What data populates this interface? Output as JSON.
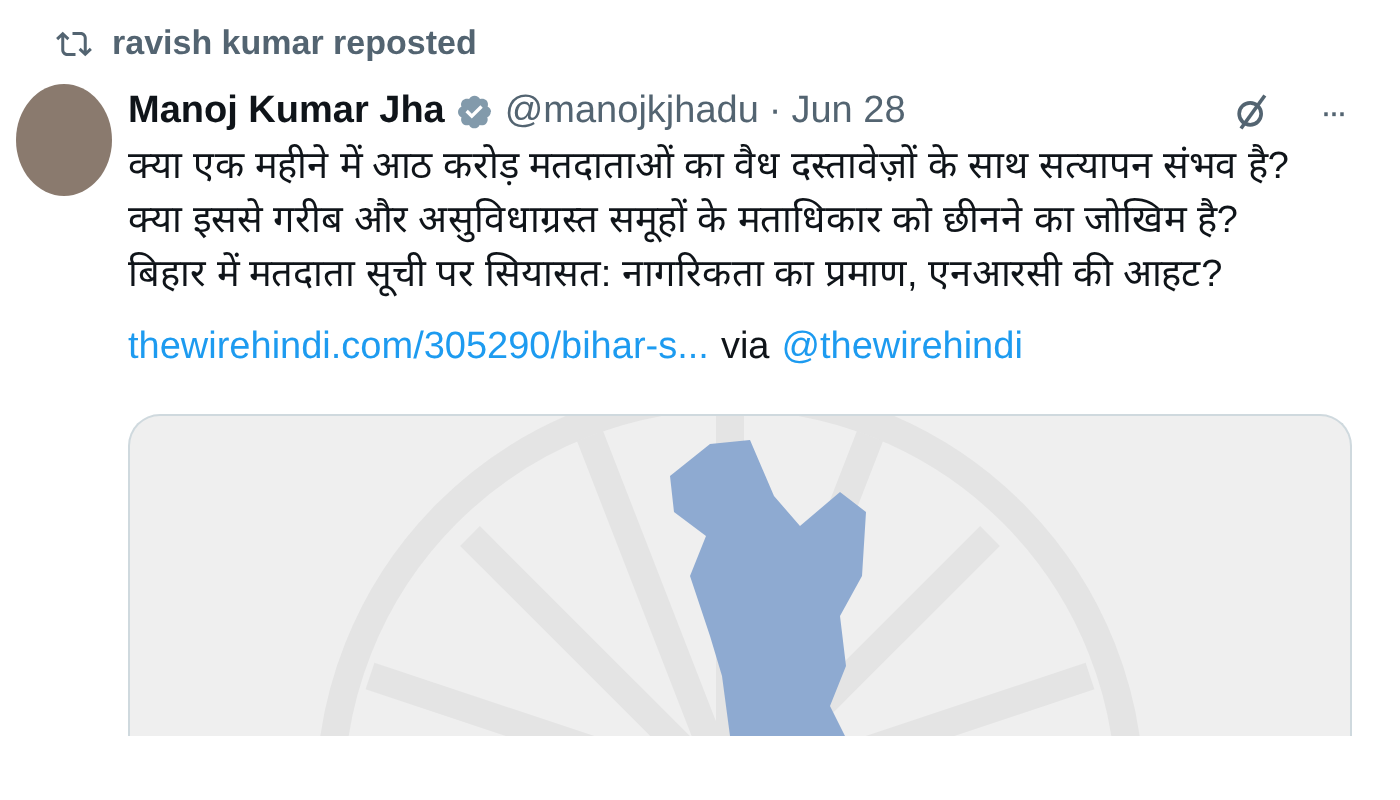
{
  "repost": {
    "text": "ravish kumar reposted"
  },
  "author": {
    "name": "Manoj Kumar Jha",
    "verified": true,
    "handle": "@manojkjhadu",
    "separator": "·",
    "date": "Jun 28"
  },
  "menu": {
    "label": "···"
  },
  "body": [
    "क्या एक महीने में आठ करोड़ मतदाताओं का वैध दस्तावेज़ों के साथ सत्यापन संभव है? क्या इससे गरीब और असुविधाग्रस्त समूहों के मताधिकार को छीनने का जोखिम है?",
    "बिहार में मतदाता सूची पर सियासत: नागरिकता का प्रमाण, एनआरसी की आहट?"
  ],
  "link": {
    "url": "thewirehindi.com/305290/bihar-s...",
    "via": "via",
    "mention": "@thewirehindi"
  }
}
